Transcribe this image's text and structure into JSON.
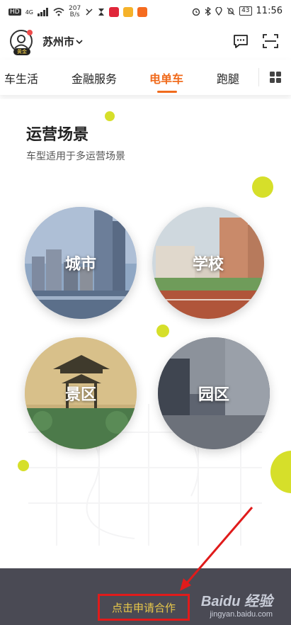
{
  "status_bar": {
    "network": "HD",
    "signal_gen": "4G",
    "speed_value": "207",
    "speed_unit": "B/s",
    "battery": "43",
    "time": "11:56"
  },
  "header": {
    "city": "苏州市",
    "avatar_badge": "黄金",
    "icons": [
      "message-icon",
      "scan-icon"
    ]
  },
  "tabs": [
    {
      "label": "车生活",
      "active": false
    },
    {
      "label": "金融服务",
      "active": false
    },
    {
      "label": "电单车",
      "active": true
    },
    {
      "label": "跑腿",
      "active": false
    }
  ],
  "section": {
    "title": "运营场景",
    "subtitle": "车型适用于多运营场景"
  },
  "scenes": [
    {
      "label": "城市"
    },
    {
      "label": "学校"
    },
    {
      "label": "景区"
    },
    {
      "label": "园区"
    }
  ],
  "bottom": {
    "apply_label": "点击申请合作"
  },
  "watermark": {
    "brand": "Baidu 经验",
    "url": "jingyan.baidu.com"
  },
  "colors": {
    "accent": "#f06b1d",
    "dot": "#d6df2a",
    "bottom_bar": "#4a4a54",
    "apply_text": "#e8c84a",
    "highlight": "#e01b1b"
  }
}
